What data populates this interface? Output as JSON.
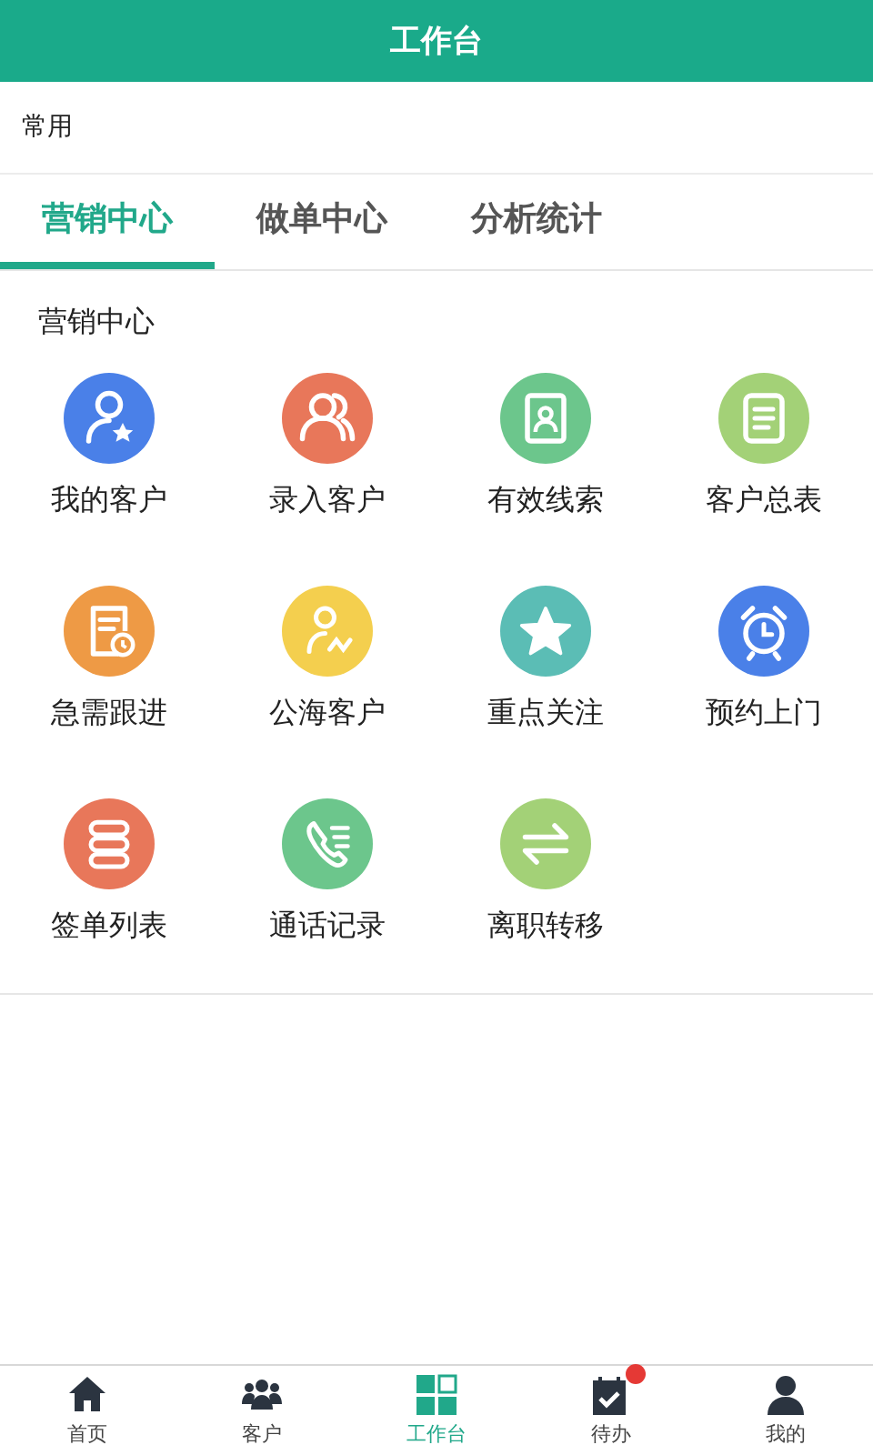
{
  "header": {
    "title": "工作台"
  },
  "frequent": {
    "label": "常用"
  },
  "tabs": [
    {
      "label": "营销中心",
      "selected": true
    },
    {
      "label": "做单中心",
      "selected": false
    },
    {
      "label": "分析统计",
      "selected": false
    }
  ],
  "section": {
    "title": "营销中心",
    "items": [
      {
        "label": "我的客户",
        "kind": "user-star",
        "color": "#4a80e8"
      },
      {
        "label": "录入客户",
        "kind": "users",
        "color": "#e8775a"
      },
      {
        "label": "有效线索",
        "kind": "contact",
        "color": "#6cc68c"
      },
      {
        "label": "客户总表",
        "kind": "document",
        "color": "#a3d177"
      },
      {
        "label": "急需跟进",
        "kind": "doc-clock",
        "color": "#ee9a45"
      },
      {
        "label": "公海客户",
        "kind": "user-group",
        "color": "#f4cf4e"
      },
      {
        "label": "重点关注",
        "kind": "star",
        "color": "#5bbdb5"
      },
      {
        "label": "预约上门",
        "kind": "alarm",
        "color": "#4a80e8"
      },
      {
        "label": "签单列表",
        "kind": "stack",
        "color": "#e8775a"
      },
      {
        "label": "通话记录",
        "kind": "phone",
        "color": "#6cc68c"
      },
      {
        "label": "离职转移",
        "kind": "swap",
        "color": "#a3d177"
      }
    ]
  },
  "bottom_nav": [
    {
      "label": "首页",
      "kind": "home",
      "selected": false,
      "badge": false
    },
    {
      "label": "客户",
      "kind": "people",
      "selected": false,
      "badge": false
    },
    {
      "label": "工作台",
      "kind": "grid",
      "selected": true,
      "badge": false
    },
    {
      "label": "待办",
      "kind": "todo",
      "selected": false,
      "badge": true
    },
    {
      "label": "我的",
      "kind": "person",
      "selected": false,
      "badge": false
    }
  ]
}
